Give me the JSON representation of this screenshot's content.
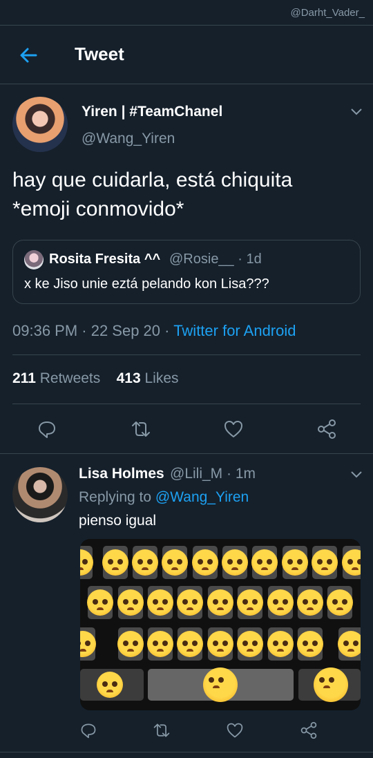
{
  "watermark": "@Darht_Vader_",
  "header": {
    "title": "Tweet",
    "back_icon": "arrow-left-icon"
  },
  "tweet": {
    "author_name": "Yiren | #TeamChanel",
    "author_handle": "@Wang_Yiren",
    "text_line1": "hay que cuidarla, está chiquita",
    "text_line2": "*emoji conmovido*",
    "quote": {
      "name": "Rosita Fresita ^^",
      "handle_time": "@Rosie__ · 1d",
      "text": "x ke Jiso unie eztá pelando kon Lisa???"
    },
    "time": "09:36 PM · 22 Sep 20 · ",
    "source": "Twitter for Android",
    "retweets": "211",
    "retweets_label": " Retweets",
    "likes": "413",
    "likes_label": " Likes"
  },
  "reply": {
    "author_name": "Lisa Holmes",
    "handle_time": "@Lili_M · 1m",
    "replying_prefix": "Replying to ",
    "replying_to": "@Wang_Yiren",
    "text": "pienso igual"
  },
  "colors": {
    "background": "#15202b",
    "accent": "#1da1f2",
    "muted": "#8899a6",
    "border": "#38444d"
  }
}
